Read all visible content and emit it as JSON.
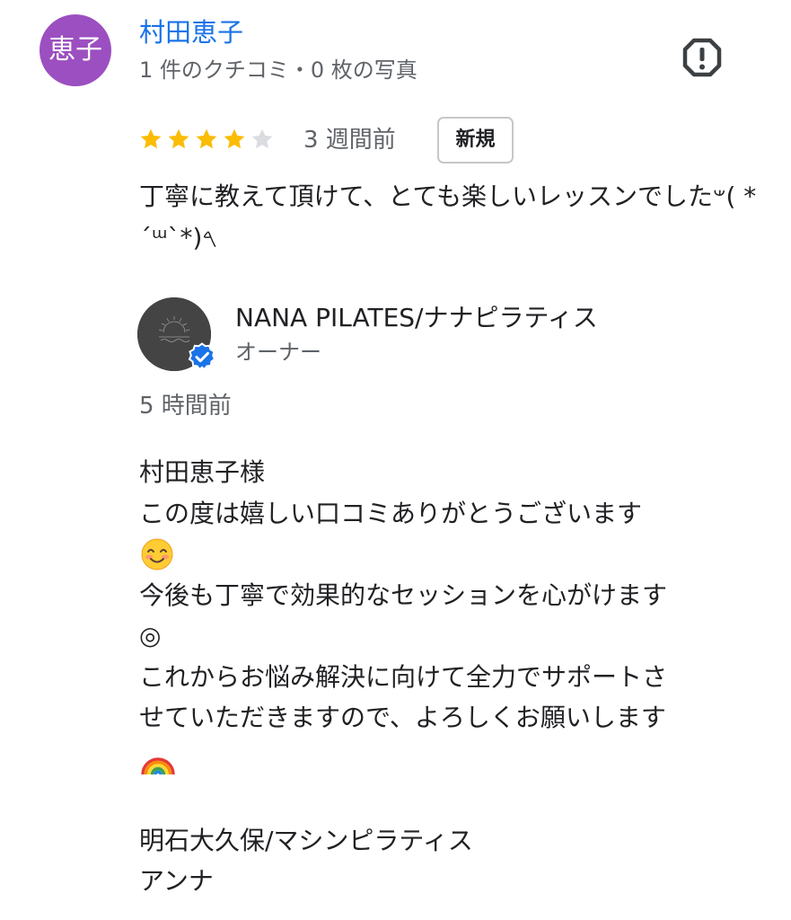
{
  "review": {
    "avatar_text": "恵子",
    "reviewer_name": "村田恵子",
    "reviewer_meta": "1 件のクチコミ・0 枚の写真",
    "rating": 4,
    "rating_max": 5,
    "time": "3 週間前",
    "badge": "新規",
    "text": "丁寧に教えて頂けて、とても楽しいレッスンでした𐤔( *´ᵚ`*)𐤓"
  },
  "owner_reply": {
    "name": "NANA PILATES/ナナピラティス",
    "role": "オーナー",
    "time": "5 時間前",
    "lines": {
      "l1": "村田恵子様",
      "l2": "この度は嬉しい口コミありがとうございます",
      "l3": "今後も丁寧で効果的なセッションを心がけます",
      "l4": "◎",
      "l5": "これからお悩み解決に向けて全力でサポートさ",
      "l6": "せていただきますので、よろしくお願いします",
      "l7": "明石大久保/マシンピラティス",
      "l8": "アンナ"
    }
  },
  "colors": {
    "avatar_bg": "#9c4fc0",
    "name_link": "#1a73e8",
    "star_filled": "#fbbc04",
    "star_empty": "#dadce0",
    "verified": "#1a73e8",
    "secondary_text": "#5f6368"
  },
  "icons": {
    "report": "report-octagon-icon",
    "verified": "verified-check-icon",
    "smile": "smiling-face-emoji",
    "rainbow": "rainbow-emoji"
  }
}
